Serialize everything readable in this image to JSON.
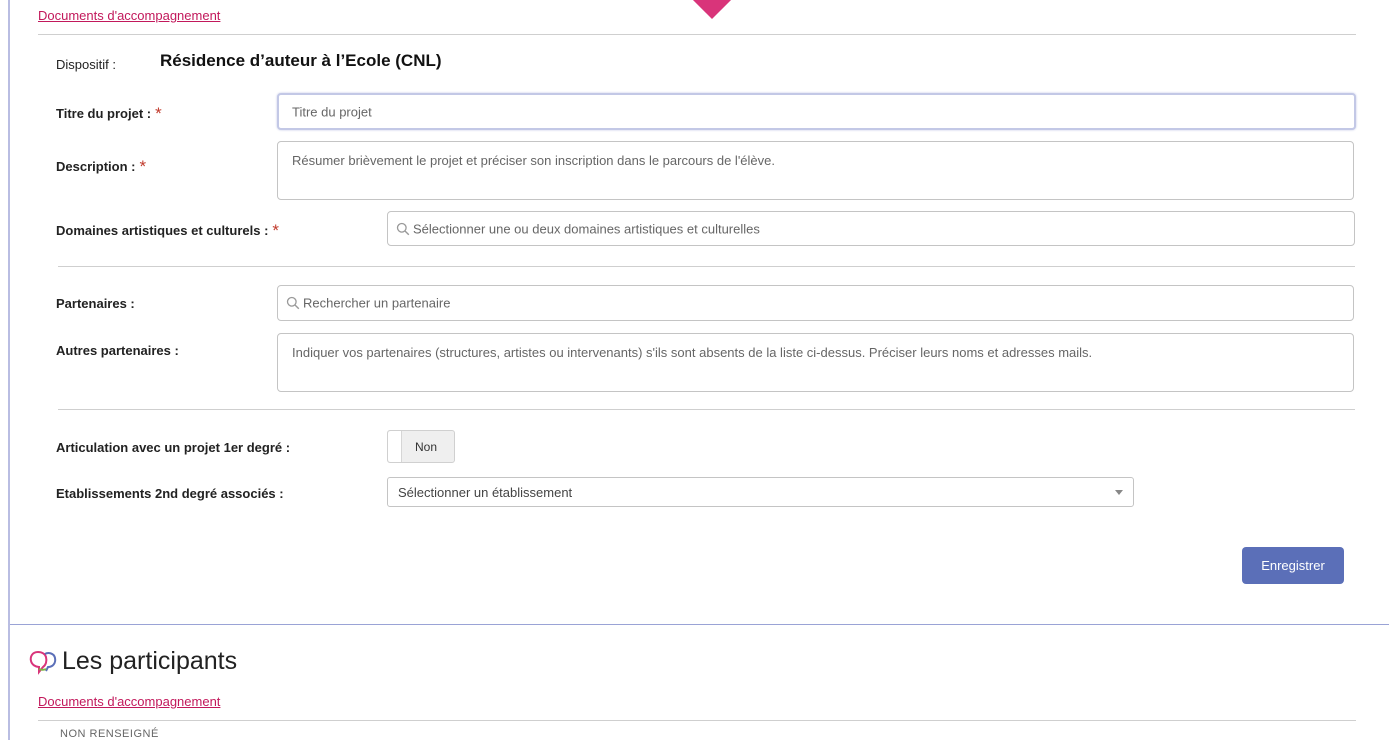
{
  "doc_link_top": "Documents d'accompagnement",
  "dispositif": {
    "label": "Dispositif :",
    "value": "Résidence d’auteur à l’Ecole (CNL)"
  },
  "required_marker": "*",
  "titre": {
    "label": "Titre du projet :",
    "placeholder": "Titre du projet"
  },
  "description": {
    "label": "Description :",
    "placeholder": "Résumer brièvement le projet et préciser son inscription dans le parcours de l'élève."
  },
  "domaines": {
    "label": "Domaines artistiques et culturels :",
    "placeholder": "Sélectionner une ou deux domaines artistiques et culturelles"
  },
  "partenaires": {
    "label": "Partenaires :",
    "placeholder": "Rechercher un partenaire"
  },
  "autres_partenaires": {
    "label": "Autres partenaires :",
    "placeholder": "Indiquer vos partenaires (structures, artistes ou intervenants) s'ils sont absents de la liste ci-dessus. Préciser leurs noms et adresses mails."
  },
  "articulation": {
    "label": "Articulation avec un projet 1er degré :",
    "toggle_value": "Non"
  },
  "etablissements": {
    "label": "Etablissements 2nd degré associés :",
    "selected": "Sélectionner un établissement"
  },
  "save_button": "Enregistrer",
  "participants": {
    "title": "Les participants",
    "doc_link": "Documents d'accompagnement",
    "status": "NON RENSEIGNÉ"
  },
  "colors": {
    "accent_blue": "#5b6fb8",
    "link_pink": "#c2185b",
    "required_red": "#c0392b"
  },
  "icons": {
    "search": "search-icon",
    "participants": "participants-icon",
    "dropdown": "chevron-down-icon"
  }
}
